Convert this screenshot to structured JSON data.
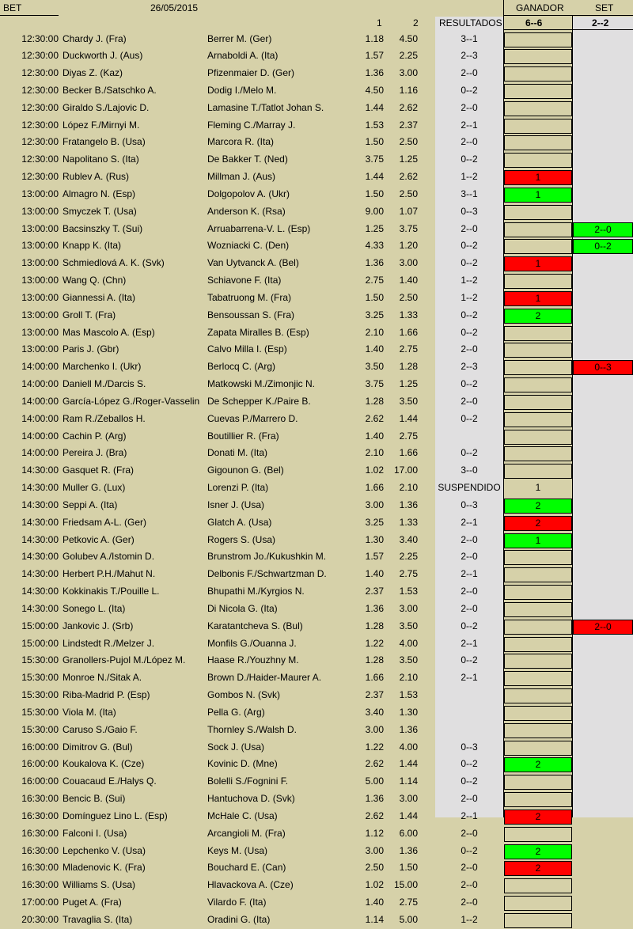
{
  "header": {
    "bet": "BET",
    "date": "26/05/2015",
    "ganador": "GANADOR",
    "set": "SET",
    "col1": "1",
    "col2": "2",
    "resultados": "RESULTADOS",
    "ganador_score": "6--6",
    "set_score": "2--2"
  },
  "rows": [
    {
      "time": "12:30:00",
      "p1": "Chardy J. (Fra)",
      "p2": "Berrer M. (Ger)",
      "o1": "1.18",
      "o2": "4.50",
      "res": "3--1",
      "gan": "",
      "gan_style": "",
      "set": "",
      "set_style": ""
    },
    {
      "time": "12:30:00",
      "p1": "Duckworth J. (Aus)",
      "p2": "Arnaboldi A. (Ita)",
      "o1": "1.57",
      "o2": "2.25",
      "res": "2--3",
      "gan": "",
      "gan_style": "",
      "set": "",
      "set_style": ""
    },
    {
      "time": "12:30:00",
      "p1": "Diyas Z. (Kaz)",
      "p2": "Pfizenmaier D. (Ger)",
      "o1": "1.36",
      "o2": "3.00",
      "res": "2--0",
      "gan": "",
      "gan_style": "",
      "set": "",
      "set_style": ""
    },
    {
      "time": "12:30:00",
      "p1": "Becker B./Satschko A.",
      "p2": "Dodig I./Melo M.",
      "o1": "4.50",
      "o2": "1.16",
      "res": "0--2",
      "gan": "",
      "gan_style": "",
      "set": "",
      "set_style": ""
    },
    {
      "time": "12:30:00",
      "p1": "Giraldo S./Lajovic D.",
      "p2": "Lamasine T./Tatlot Johan S.",
      "o1": "1.44",
      "o2": "2.62",
      "res": "2--0",
      "gan": "",
      "gan_style": "",
      "set": "",
      "set_style": ""
    },
    {
      "time": "12:30:00",
      "p1": "López F./Mirnyi M.",
      "p2": "Fleming C./Marray J.",
      "o1": "1.53",
      "o2": "2.37",
      "res": "2--1",
      "gan": "",
      "gan_style": "",
      "set": "",
      "set_style": ""
    },
    {
      "time": "12:30:00",
      "p1": "Fratangelo B. (Usa)",
      "p2": "Marcora R. (Ita)",
      "o1": "1.50",
      "o2": "2.50",
      "res": "2--0",
      "gan": "",
      "gan_style": "",
      "set": "",
      "set_style": ""
    },
    {
      "time": "12:30:00",
      "p1": "Napolitano S. (Ita)",
      "p2": "De Bakker T. (Ned)",
      "o1": "3.75",
      "o2": "1.25",
      "res": "0--2",
      "gan": "",
      "gan_style": "",
      "set": "",
      "set_style": ""
    },
    {
      "time": "12:30:00",
      "p1": "Rublev A. (Rus)",
      "p2": "Millman J. (Aus)",
      "o1": "1.44",
      "o2": "2.62",
      "res": "1--2",
      "gan": "1",
      "gan_style": "red",
      "set": "",
      "set_style": ""
    },
    {
      "time": "13:00:00",
      "p1": "Almagro N. (Esp)",
      "p2": "Dolgopolov A. (Ukr)",
      "o1": "1.50",
      "o2": "2.50",
      "res": "3--1",
      "gan": "1",
      "gan_style": "green",
      "set": "",
      "set_style": ""
    },
    {
      "time": "13:00:00",
      "p1": "Smyczek T. (Usa)",
      "p2": "Anderson K. (Rsa)",
      "o1": "9.00",
      "o2": "1.07",
      "res": "0--3",
      "gan": "",
      "gan_style": "",
      "set": "",
      "set_style": ""
    },
    {
      "time": "13:00:00",
      "p1": "Bacsinszky T. (Sui)",
      "p2": "Arruabarrena-V. L. (Esp)",
      "o1": "1.25",
      "o2": "3.75",
      "res": "2--0",
      "gan": "",
      "gan_style": "",
      "set": "2--0",
      "set_style": "green"
    },
    {
      "time": "13:00:00",
      "p1": "Knapp K. (Ita)",
      "p2": "Wozniacki C. (Den)",
      "o1": "4.33",
      "o2": "1.20",
      "res": "0--2",
      "gan": "",
      "gan_style": "",
      "set": "0--2",
      "set_style": "green"
    },
    {
      "time": "13:00:00",
      "p1": "Schmiedlová A. K. (Svk)",
      "p2": "Van Uytvanck A. (Bel)",
      "o1": "1.36",
      "o2": "3.00",
      "res": "0--2",
      "gan": "1",
      "gan_style": "red",
      "set": "",
      "set_style": ""
    },
    {
      "time": "13:00:00",
      "p1": "Wang Q. (Chn)",
      "p2": "Schiavone F. (Ita)",
      "o1": "2.75",
      "o2": "1.40",
      "res": "1--2",
      "gan": "",
      "gan_style": "",
      "set": "",
      "set_style": ""
    },
    {
      "time": "13:00:00",
      "p1": "Giannessi A. (Ita)",
      "p2": "Tabatruong M. (Fra)",
      "o1": "1.50",
      "o2": "2.50",
      "res": "1--2",
      "gan": "1",
      "gan_style": "red",
      "set": "",
      "set_style": ""
    },
    {
      "time": "13:00:00",
      "p1": "Groll T. (Fra)",
      "p2": "Bensoussan S. (Fra)",
      "o1": "3.25",
      "o2": "1.33",
      "res": "0--2",
      "gan": "2",
      "gan_style": "green",
      "set": "",
      "set_style": ""
    },
    {
      "time": "13:00:00",
      "p1": "Mas Mascolo A. (Esp)",
      "p2": "Zapata Miralles B. (Esp)",
      "o1": "2.10",
      "o2": "1.66",
      "res": "0--2",
      "gan": "",
      "gan_style": "",
      "set": "",
      "set_style": ""
    },
    {
      "time": "13:00:00",
      "p1": "Paris J. (Gbr)",
      "p2": "Calvo Milla I. (Esp)",
      "o1": "1.40",
      "o2": "2.75",
      "res": "2--0",
      "gan": "",
      "gan_style": "",
      "set": "",
      "set_style": ""
    },
    {
      "time": "14:00:00",
      "p1": "Marchenko I. (Ukr)",
      "p2": "Berlocq C. (Arg)",
      "o1": "3.50",
      "o2": "1.28",
      "res": "2--3",
      "gan": "",
      "gan_style": "",
      "set": "0--3",
      "set_style": "red"
    },
    {
      "time": "14:00:00",
      "p1": "Daniell M./Darcis S.",
      "p2": "Matkowski M./Zimonjic N.",
      "o1": "3.75",
      "o2": "1.25",
      "res": "0--2",
      "gan": "",
      "gan_style": "",
      "set": "",
      "set_style": ""
    },
    {
      "time": "14:00:00",
      "p1": "García-López G./Roger-Vasselin",
      "p2": "De Schepper K./Paire B.",
      "o1": "1.28",
      "o2": "3.50",
      "res": "2--0",
      "gan": "",
      "gan_style": "",
      "set": "",
      "set_style": ""
    },
    {
      "time": "14:00:00",
      "p1": "Ram R./Zeballos H.",
      "p2": "Cuevas P./Marrero D.",
      "o1": "2.62",
      "o2": "1.44",
      "res": "0--2",
      "gan": "",
      "gan_style": "",
      "set": "",
      "set_style": ""
    },
    {
      "time": "14:00:00",
      "p1": "Cachin P. (Arg)",
      "p2": "Boutillier R. (Fra)",
      "o1": "1.40",
      "o2": "2.75",
      "res": "",
      "gan": "",
      "gan_style": "",
      "set": "",
      "set_style": ""
    },
    {
      "time": "14:00:00",
      "p1": "Pereira J. (Bra)",
      "p2": "Donati M. (Ita)",
      "o1": "2.10",
      "o2": "1.66",
      "res": "0--2",
      "gan": "",
      "gan_style": "",
      "set": "",
      "set_style": ""
    },
    {
      "time": "14:30:00",
      "p1": "Gasquet R. (Fra)",
      "p2": "Gigounon G. (Bel)",
      "o1": "1.02",
      "o2": "17.00",
      "res": "3--0",
      "gan": "",
      "gan_style": "",
      "set": "",
      "set_style": ""
    },
    {
      "time": "14:30:00",
      "p1": "Muller G. (Lux)",
      "p2": "Lorenzi P. (Ita)",
      "o1": "1.66",
      "o2": "2.10",
      "res": "SUSPENDIDO",
      "gan": "1",
      "gan_style": "none",
      "set": "",
      "set_style": ""
    },
    {
      "time": "14:30:00",
      "p1": "Seppi A. (Ita)",
      "p2": "Isner J. (Usa)",
      "o1": "3.00",
      "o2": "1.36",
      "res": "0--3",
      "gan": "2",
      "gan_style": "green",
      "set": "",
      "set_style": ""
    },
    {
      "time": "14:30:00",
      "p1": "Friedsam A-L. (Ger)",
      "p2": "Glatch A. (Usa)",
      "o1": "3.25",
      "o2": "1.33",
      "res": "2--1",
      "gan": "2",
      "gan_style": "red",
      "set": "",
      "set_style": ""
    },
    {
      "time": "14:30:00",
      "p1": "Petkovic A. (Ger)",
      "p2": "Rogers S. (Usa)",
      "o1": "1.30",
      "o2": "3.40",
      "res": "2--0",
      "gan": "1",
      "gan_style": "green",
      "set": "",
      "set_style": ""
    },
    {
      "time": "14:30:00",
      "p1": "Golubev A./Istomin D.",
      "p2": "Brunstrom Jo./Kukushkin M.",
      "o1": "1.57",
      "o2": "2.25",
      "res": "2--0",
      "gan": "",
      "gan_style": "",
      "set": "",
      "set_style": ""
    },
    {
      "time": "14:30:00",
      "p1": "Herbert P.H./Mahut N.",
      "p2": "Delbonis F./Schwartzman D.",
      "o1": "1.40",
      "o2": "2.75",
      "res": "2--1",
      "gan": "",
      "gan_style": "",
      "set": "",
      "set_style": ""
    },
    {
      "time": "14:30:00",
      "p1": "Kokkinakis T./Pouille L.",
      "p2": "Bhupathi M./Kyrgios N.",
      "o1": "2.37",
      "o2": "1.53",
      "res": "2--0",
      "gan": "",
      "gan_style": "",
      "set": "",
      "set_style": ""
    },
    {
      "time": "14:30:00",
      "p1": "Sonego L. (Ita)",
      "p2": "Di Nicola G. (Ita)",
      "o1": "1.36",
      "o2": "3.00",
      "res": "2--0",
      "gan": "",
      "gan_style": "",
      "set": "",
      "set_style": ""
    },
    {
      "time": "15:00:00",
      "p1": "Jankovic J. (Srb)",
      "p2": "Karatantcheva S. (Bul)",
      "o1": "1.28",
      "o2": "3.50",
      "res": "0--2",
      "gan": "",
      "gan_style": "",
      "set": "2--0",
      "set_style": "red"
    },
    {
      "time": "15:00:00",
      "p1": "Lindstedt R./Melzer J.",
      "p2": "Monfils G./Ouanna J.",
      "o1": "1.22",
      "o2": "4.00",
      "res": "2--1",
      "gan": "",
      "gan_style": "",
      "set": "",
      "set_style": ""
    },
    {
      "time": "15:30:00",
      "p1": "Granollers-Pujol M./López M.",
      "p2": "Haase R./Youzhny M.",
      "o1": "1.28",
      "o2": "3.50",
      "res": "0--2",
      "gan": "",
      "gan_style": "",
      "set": "",
      "set_style": ""
    },
    {
      "time": "15:30:00",
      "p1": "Monroe N./Sitak A.",
      "p2": "Brown D./Haider-Maurer A.",
      "o1": "1.66",
      "o2": "2.10",
      "res": "2--1",
      "gan": "",
      "gan_style": "",
      "set": "",
      "set_style": ""
    },
    {
      "time": "15:30:00",
      "p1": "Riba-Madrid P. (Esp)",
      "p2": "Gombos N. (Svk)",
      "o1": "2.37",
      "o2": "1.53",
      "res": "",
      "gan": "",
      "gan_style": "",
      "set": "",
      "set_style": ""
    },
    {
      "time": "15:30:00",
      "p1": "Viola M. (Ita)",
      "p2": "Pella G. (Arg)",
      "o1": "3.40",
      "o2": "1.30",
      "res": "",
      "gan": "",
      "gan_style": "",
      "set": "",
      "set_style": ""
    },
    {
      "time": "15:30:00",
      "p1": "Caruso S./Gaio F.",
      "p2": "Thornley S./Walsh D.",
      "o1": "3.00",
      "o2": "1.36",
      "res": "",
      "gan": "",
      "gan_style": "",
      "set": "",
      "set_style": ""
    },
    {
      "time": "16:00:00",
      "p1": "Dimitrov G. (Bul)",
      "p2": "Sock J. (Usa)",
      "o1": "1.22",
      "o2": "4.00",
      "res": "0--3",
      "gan": "",
      "gan_style": "",
      "set": "",
      "set_style": ""
    },
    {
      "time": "16:00:00",
      "p1": "Koukalova K. (Cze)",
      "p2": "Kovinic D. (Mne)",
      "o1": "2.62",
      "o2": "1.44",
      "res": "0--2",
      "gan": "2",
      "gan_style": "green",
      "set": "",
      "set_style": ""
    },
    {
      "time": "16:00:00",
      "p1": "Couacaud E./Halys Q.",
      "p2": "Bolelli S./Fognini F.",
      "o1": "5.00",
      "o2": "1.14",
      "res": "0--2",
      "gan": "",
      "gan_style": "",
      "set": "",
      "set_style": ""
    },
    {
      "time": "16:30:00",
      "p1": "Bencic B. (Sui)",
      "p2": "Hantuchova D. (Svk)",
      "o1": "1.36",
      "o2": "3.00",
      "res": "2--0",
      "gan": "",
      "gan_style": "",
      "set": "",
      "set_style": ""
    },
    {
      "time": "16:30:00",
      "p1": "Domínguez Lino L. (Esp)",
      "p2": "McHale C. (Usa)",
      "o1": "2.62",
      "o2": "1.44",
      "res": "2--1",
      "gan": "2",
      "gan_style": "red",
      "set": "",
      "set_style": ""
    },
    {
      "time": "16:30:00",
      "p1": "Falconi I. (Usa)",
      "p2": "Arcangioli M. (Fra)",
      "o1": "1.12",
      "o2": "6.00",
      "res": "2--0",
      "gan": "",
      "gan_style": "",
      "set": "",
      "set_style": ""
    },
    {
      "time": "16:30:00",
      "p1": "Lepchenko V. (Usa)",
      "p2": "Keys M. (Usa)",
      "o1": "3.00",
      "o2": "1.36",
      "res": "0--2",
      "gan": "2",
      "gan_style": "green",
      "set": "",
      "set_style": ""
    },
    {
      "time": "16:30:00",
      "p1": "Mladenovic K. (Fra)",
      "p2": "Bouchard E. (Can)",
      "o1": "2.50",
      "o2": "1.50",
      "res": "2--0",
      "gan": "2",
      "gan_style": "red",
      "set": "",
      "set_style": ""
    },
    {
      "time": "16:30:00",
      "p1": "Williams S. (Usa)",
      "p2": "Hlavackova A. (Cze)",
      "o1": "1.02",
      "o2": "15.00",
      "res": "2--0",
      "gan": "",
      "gan_style": "",
      "set": "",
      "set_style": ""
    },
    {
      "time": "17:00:00",
      "p1": "Puget A. (Fra)",
      "p2": "Vilardo F. (Ita)",
      "o1": "1.40",
      "o2": "2.75",
      "res": "2--0",
      "gan": "",
      "gan_style": "",
      "set": "",
      "set_style": ""
    },
    {
      "time": "20:30:00",
      "p1": "Travaglia S. (Ita)",
      "p2": "Oradini G. (Ita)",
      "o1": "1.14",
      "o2": "5.00",
      "res": "1--2",
      "gan": "",
      "gan_style": "",
      "set": "",
      "set_style": ""
    }
  ]
}
